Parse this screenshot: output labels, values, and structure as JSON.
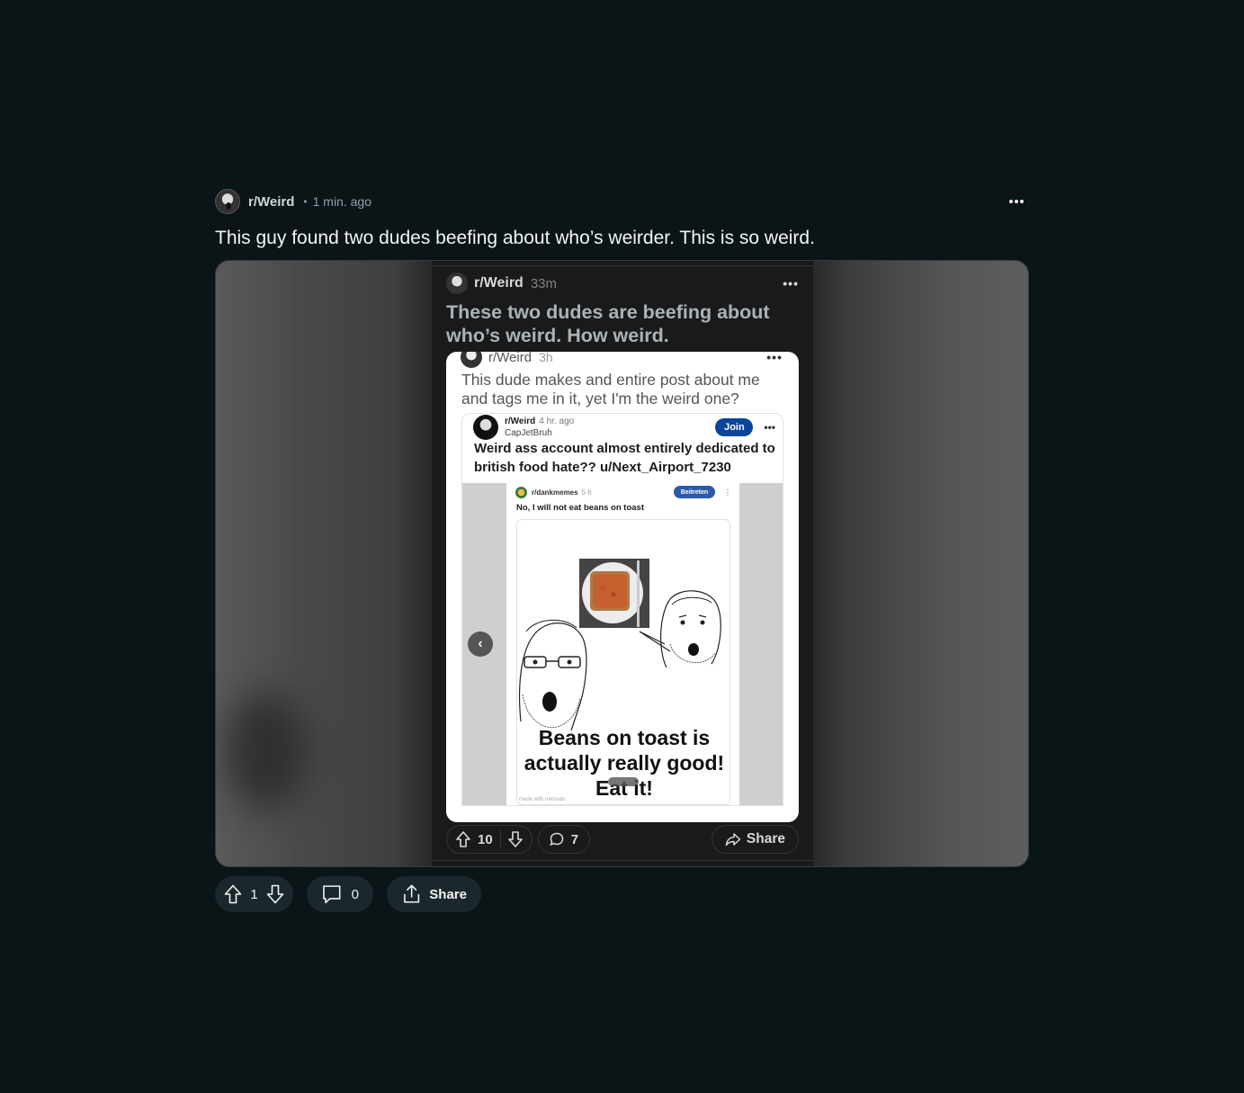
{
  "post": {
    "subreddit": "r/Weird",
    "separator": "•",
    "time": "1 min. ago",
    "more": "•••",
    "title": "This guy found two dudes beefing about who’s weirder. This is so weird."
  },
  "screenshot": {
    "subreddit": "r/Weird",
    "time": "33m",
    "more": "•••",
    "title": "These two dudes are beefing about who’s weird. How weird.",
    "card": {
      "subreddit": "r/Weird",
      "time": "3h",
      "more": "•••",
      "title": "This dude makes and entire post about me and tags me in it, yet I'm the weird one?",
      "inner": {
        "subreddit": "r/Weird",
        "time": "4 hr. ago",
        "user": "CapJetBruh",
        "join_label": "Join",
        "more": "•••",
        "title": "Weird ass account almost entirely dedicated to british food hate?? u/Next_Airport_7230",
        "gallery": {
          "subreddit": "r/dankmemes",
          "time": "5 h",
          "join_label": "Beitreten",
          "more": "⋮",
          "title": "No, I will not eat beans on toast",
          "meme_text": "Beans on toast is actually really good! Eat it!",
          "watermark": "made with mematic"
        }
      }
    },
    "actions": {
      "upvotes": "10",
      "comments": "7",
      "share_label": "Share"
    }
  },
  "actions": {
    "upvotes": "1",
    "comments": "0",
    "share_label": "Share"
  }
}
